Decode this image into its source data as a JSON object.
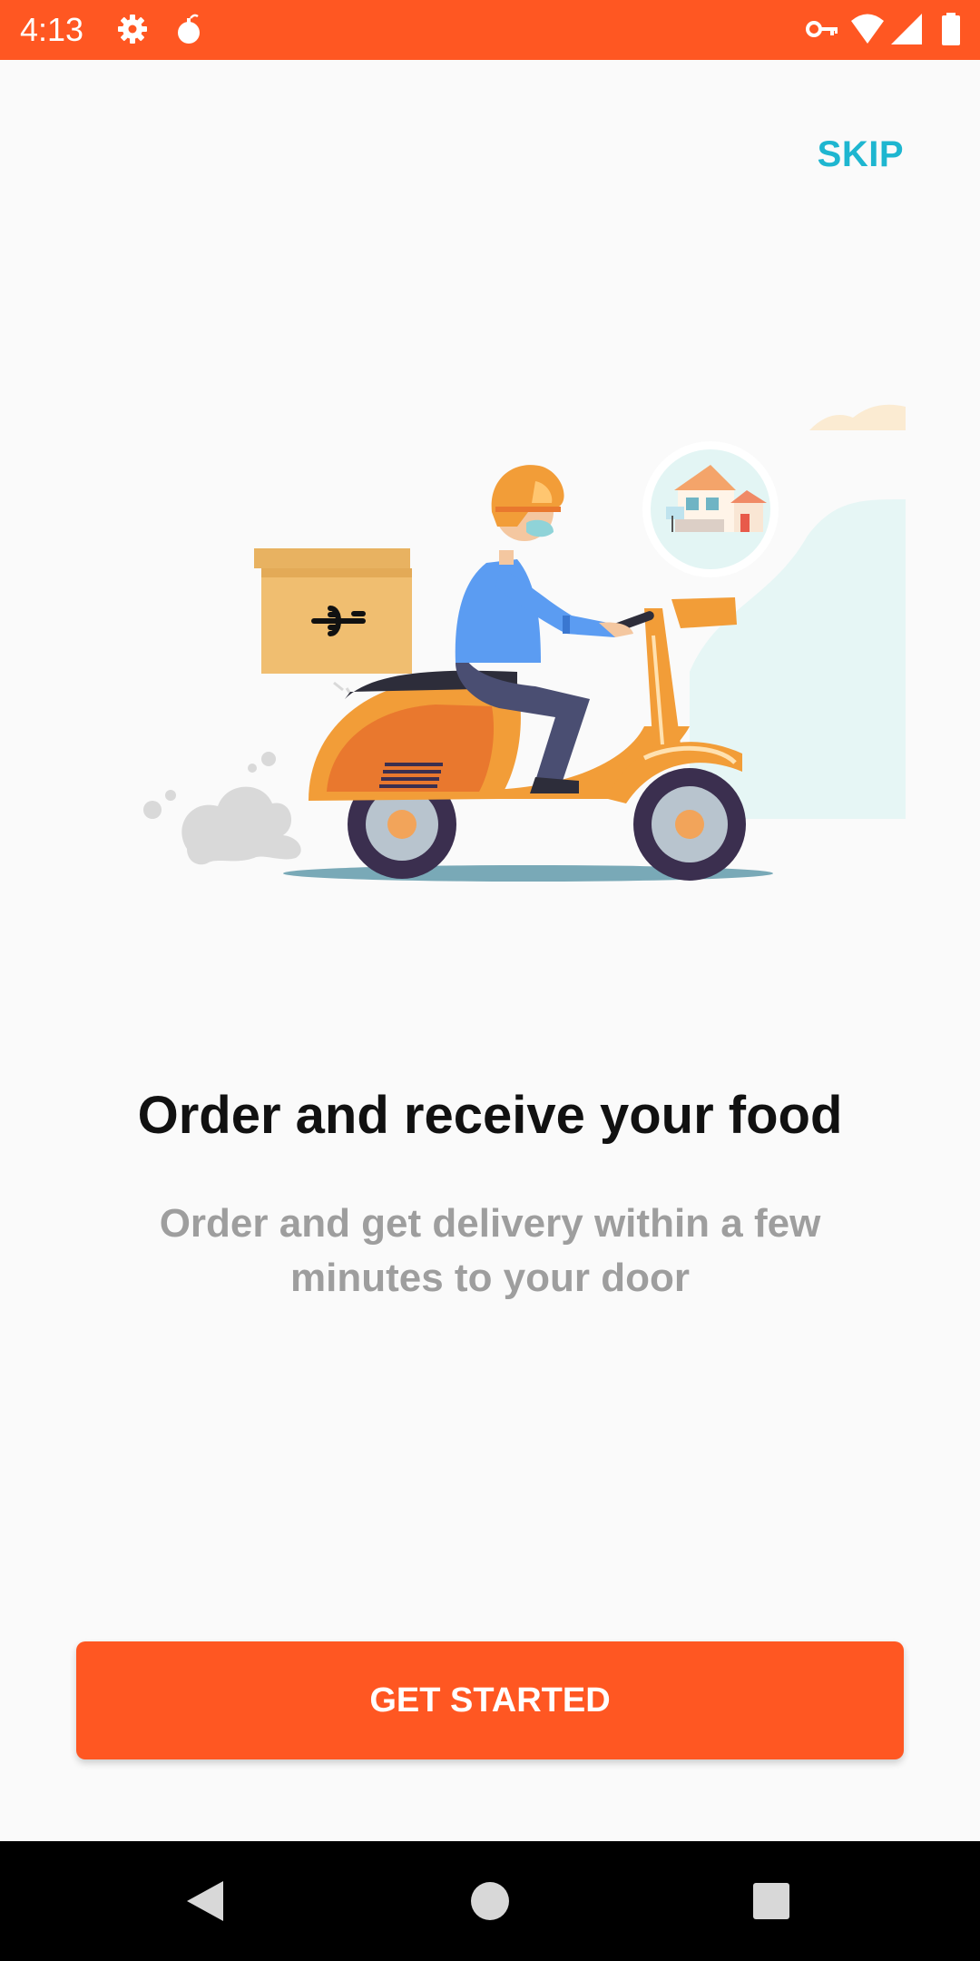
{
  "status_bar": {
    "time": "4:13",
    "left_icons": [
      "gear-icon",
      "bomb-icon"
    ],
    "right_icons": [
      "key-icon",
      "wifi-icon",
      "signal-icon",
      "battery-icon"
    ],
    "color": "#FF5722"
  },
  "onboarding": {
    "skip_label": "SKIP",
    "title": "Order and receive your food",
    "subtitle": "Order and get delivery within a few minutes to your door",
    "cta_label": "GET STARTED"
  },
  "illustration": {
    "elements": [
      "delivery-box-icon",
      "delivery-rider",
      "scooter",
      "house-icon",
      "smoke-cloud"
    ]
  },
  "nav_bar": {
    "buttons": [
      "back-icon",
      "home-icon",
      "recents-icon"
    ]
  },
  "colors": {
    "accent": "#FF5722",
    "skip": "#1EB6D0",
    "title": "#111111",
    "subtitle": "#9e9e9e"
  }
}
